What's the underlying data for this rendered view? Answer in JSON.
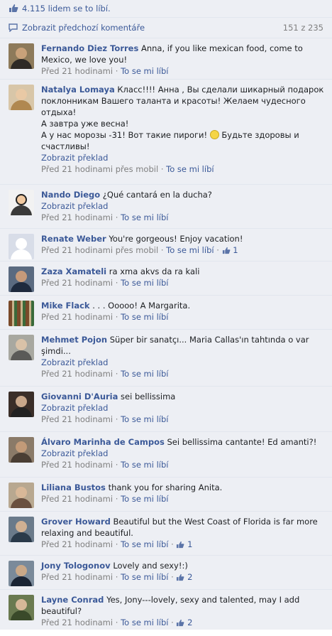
{
  "likes_text": "4.115 lidem se to líbí.",
  "previous": {
    "label": "Zobrazit předchozí komentáře",
    "count": "151 z 235"
  },
  "labels": {
    "translate": "Zobrazit překlad",
    "like": "To se mi líbí",
    "sep": "·"
  },
  "comments": [
    {
      "author": "Fernando Diez Torres",
      "text": "Anna, if you like mexican food, come to Mexico, we love you!",
      "time": "Před 21 hodinami",
      "likes": ""
    },
    {
      "author": "Natalya Lomaya",
      "text_lines": [
        "Класс!!!! Анна , Вы сделали шикарный подарок поклонникам Вашего таланта и красоты! Желаем чудесного отдыха!",
        "А завтра уже весна!",
        "А у нас морозы -31! Вот такие пироги!",
        "Будьте здоровы и счастливы!"
      ],
      "translate": true,
      "time": "Před 21 hodinami přes mobil",
      "likes": ""
    },
    {
      "author": "Nando Diego",
      "text": "¿Qué cantará en la ducha?",
      "translate": true,
      "time": "Před 21 hodinami",
      "likes": ""
    },
    {
      "author": "Renate Weber",
      "text": "You're gorgeous! Enjoy vacation!",
      "time": "Před 21 hodinami přes mobil",
      "likes": "1"
    },
    {
      "author": "Zaza Xamateli",
      "text": "ra xma akvs da ra kali",
      "time": "Před 21 hodinami",
      "likes": ""
    },
    {
      "author": "Mike Flack",
      "text": ". . . Ooooo! A Margarita.",
      "time": "Před 21 hodinami",
      "likes": ""
    },
    {
      "author": "Mehmet Pojon",
      "text": "Süper bir sanatçı... Maria Callas'ın tahtında o var şimdi...",
      "translate": true,
      "time": "Před 21 hodinami",
      "likes": ""
    },
    {
      "author": "Giovanni D'Auria",
      "text": "sei bellissima",
      "translate": true,
      "time": "Před 21 hodinami",
      "likes": ""
    },
    {
      "author": "Álvaro Marinha de Campos",
      "text": "Sei bellissima cantante! Ed amanti?!",
      "translate": true,
      "time": "Před 21 hodinami",
      "likes": ""
    },
    {
      "author": "Liliana Bustos",
      "text": "thank you for sharing Anita.",
      "time": "Před 21 hodinami",
      "likes": ""
    },
    {
      "author": "Grover Howard",
      "text": "Beautiful but the West Coast of Florida is far more relaxing and beautiful.",
      "time": "Před 21 hodinami",
      "likes": "1"
    },
    {
      "author": "Jony Tologonov",
      "text": "Lovely and sexy!:)",
      "time": "Před 21 hodinami",
      "likes": "2"
    },
    {
      "author": "Layne Conrad",
      "text": "Yes, Jony---lovely, sexy and talented, may I add beautiful?",
      "time": "Před 21 hodinami",
      "likes": "2"
    }
  ],
  "colors": {
    "link": "#3b5998",
    "muted": "#7f7f7f",
    "panel": "#edeff4"
  },
  "icons": {
    "likes": "thumbs-up-icon",
    "comments": "comment-bubble-icon",
    "emoji": "smiley-icon"
  }
}
